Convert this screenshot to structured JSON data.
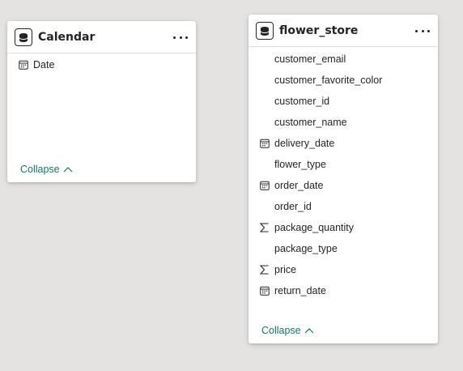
{
  "tables": {
    "calendar": {
      "title": "Calendar",
      "fields": [
        {
          "label": "Date",
          "icon": "calendar-icon"
        }
      ],
      "collapse_label": "Collapse"
    },
    "flower_store": {
      "title": "flower_store",
      "fields": [
        {
          "label": "customer_email",
          "icon": ""
        },
        {
          "label": "customer_favorite_color",
          "icon": ""
        },
        {
          "label": "customer_id",
          "icon": ""
        },
        {
          "label": "customer_name",
          "icon": ""
        },
        {
          "label": "delivery_date",
          "icon": "calendar-icon"
        },
        {
          "label": "flower_type",
          "icon": ""
        },
        {
          "label": "order_date",
          "icon": "calendar-icon"
        },
        {
          "label": "order_id",
          "icon": ""
        },
        {
          "label": "package_quantity",
          "icon": "sigma-icon"
        },
        {
          "label": "package_type",
          "icon": ""
        },
        {
          "label": "price",
          "icon": "sigma-icon"
        },
        {
          "label": "return_date",
          "icon": "calendar-icon"
        }
      ],
      "collapse_label": "Collapse"
    }
  },
  "colors": {
    "canvas": "#e4e3e1",
    "card": "#ffffff",
    "text": "#252423",
    "link": "#117865"
  }
}
